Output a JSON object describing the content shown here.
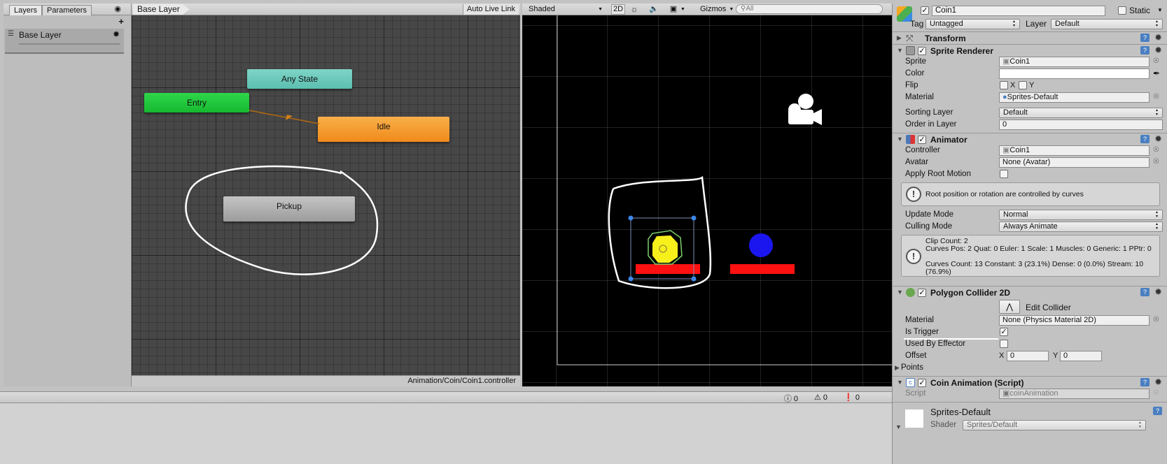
{
  "animator": {
    "tabs": [
      "Layers",
      "Parameters"
    ],
    "breadcrumb": "Base Layer",
    "auto_live_link": "Auto Live Link",
    "layer_name": "Base Layer",
    "add_label": "+",
    "states": {
      "any_state": "Any State",
      "entry": "Entry",
      "idle": "Idle",
      "pickup": "Pickup"
    },
    "footer_path": "Animation/Coin/Coin1.controller"
  },
  "scene": {
    "shading_mode": "Shaded",
    "mode_2d": "2D",
    "gizmos": "Gizmos",
    "search_placeholder": "All"
  },
  "console": {
    "counts": [
      "0",
      "0",
      "0"
    ]
  },
  "inspector": {
    "object_name": "Coin1",
    "static_label": "Static",
    "tag_label": "Tag",
    "tag_value": "Untagged",
    "layer_label": "Layer",
    "layer_value": "Default",
    "transform": {
      "title": "Transform"
    },
    "sprite_renderer": {
      "title": "Sprite Renderer",
      "sprite_label": "Sprite",
      "sprite_value": "Coin1",
      "color_label": "Color",
      "flip_label": "Flip",
      "flip_x": "X",
      "flip_y": "Y",
      "material_label": "Material",
      "material_value": "Sprites-Default",
      "sorting_layer_label": "Sorting Layer",
      "sorting_layer_value": "Default",
      "order_label": "Order in Layer",
      "order_value": "0"
    },
    "animator": {
      "title": "Animator",
      "controller_label": "Controller",
      "controller_value": "Coin1",
      "avatar_label": "Avatar",
      "avatar_value": "None (Avatar)",
      "root_motion_label": "Apply Root Motion",
      "root_motion_info": "Root position or rotation are controlled by curves",
      "update_mode_label": "Update Mode",
      "update_mode_value": "Normal",
      "culling_mode_label": "Culling Mode",
      "culling_mode_value": "Always Animate",
      "clip_info_1": "Clip Count: 2",
      "clip_info_2": "Curves Pos: 2 Quat: 0 Euler: 1 Scale: 1 Muscles: 0 Generic: 1 PPtr: 0",
      "clip_info_3": "Curves Count: 13 Constant: 3 (23.1%) Dense: 0 (0.0%) Stream: 10 (76.9%)"
    },
    "polygon_collider": {
      "title": "Polygon Collider 2D",
      "edit_collider": "Edit Collider",
      "material_label": "Material",
      "material_value": "None (Physics Material 2D)",
      "is_trigger_label": "Is Trigger",
      "used_by_effector_label": "Used By Effector",
      "offset_label": "Offset",
      "offset_x_label": "X",
      "offset_x": "0",
      "offset_y_label": "Y",
      "offset_y": "0",
      "points_label": "Points"
    },
    "coin_animation": {
      "title": "Coin Animation (Script)",
      "script_label": "Script",
      "script_value": "coinAnimation"
    },
    "material_preview": {
      "name": "Sprites-Default",
      "shader_label": "Shader",
      "shader_value": "Sprites/Default"
    }
  }
}
